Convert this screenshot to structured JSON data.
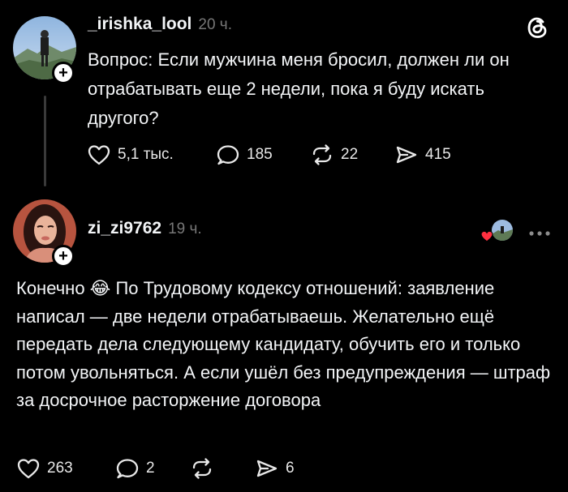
{
  "post": {
    "username": "_irishka_lool",
    "time": "20 ч.",
    "text": "Вопрос: Если мужчина меня бросил, должен ли он отрабатывать еще 2 недели, пока я буду искать другого?",
    "likes": "5,1 тыс.",
    "replies": "185",
    "reposts": "22",
    "shares": "415"
  },
  "reply": {
    "username": "zi_zi9762",
    "time": "19 ч.",
    "text": "Конечно 😂 По Трудовому кодексу отношений: заявление написал — две недели отрабатываешь. Желательно ещё передать дела следующему кандидату, обучить его и только потом увольняться. А если ушёл без предупреждения — штраф за досрочное расторжение договора",
    "likes": "263",
    "replies": "2",
    "shares": "6"
  },
  "icons": {
    "app_logo": "threads-logo-icon",
    "like": "heart-icon",
    "reply": "comment-bubble-icon",
    "repost": "repost-icon",
    "share": "send-icon",
    "more": "more-dots-icon"
  },
  "colors": {
    "background": "#000000",
    "text": "#f3f5f7",
    "muted": "#777777",
    "liked_heart": "#ff3040"
  }
}
